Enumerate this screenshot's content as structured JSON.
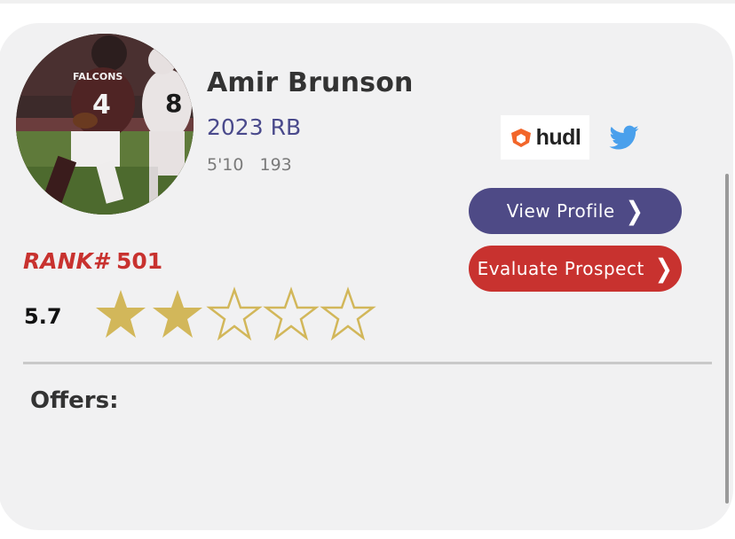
{
  "player": {
    "name": "Amir Brunson",
    "class_position": "2023 RB",
    "height": "5'10",
    "weight": "193"
  },
  "rank": {
    "label": "RANK#",
    "value": "501"
  },
  "rating": {
    "score": "5.7",
    "stars_filled": 2,
    "stars_total": 5
  },
  "links": {
    "hudl_label": "hudl",
    "twitter_icon": "twitter-bird-icon"
  },
  "buttons": {
    "view_profile": "View Profile",
    "evaluate_prospect": "Evaluate Prospect"
  },
  "offers_label": "Offers:",
  "colors": {
    "accent_purple": "#4e4a86",
    "accent_red": "#c8322f",
    "star_gold": "#d2b75a",
    "twitter_blue": "#4aa0ec",
    "hudl_orange": "#f2662a"
  }
}
